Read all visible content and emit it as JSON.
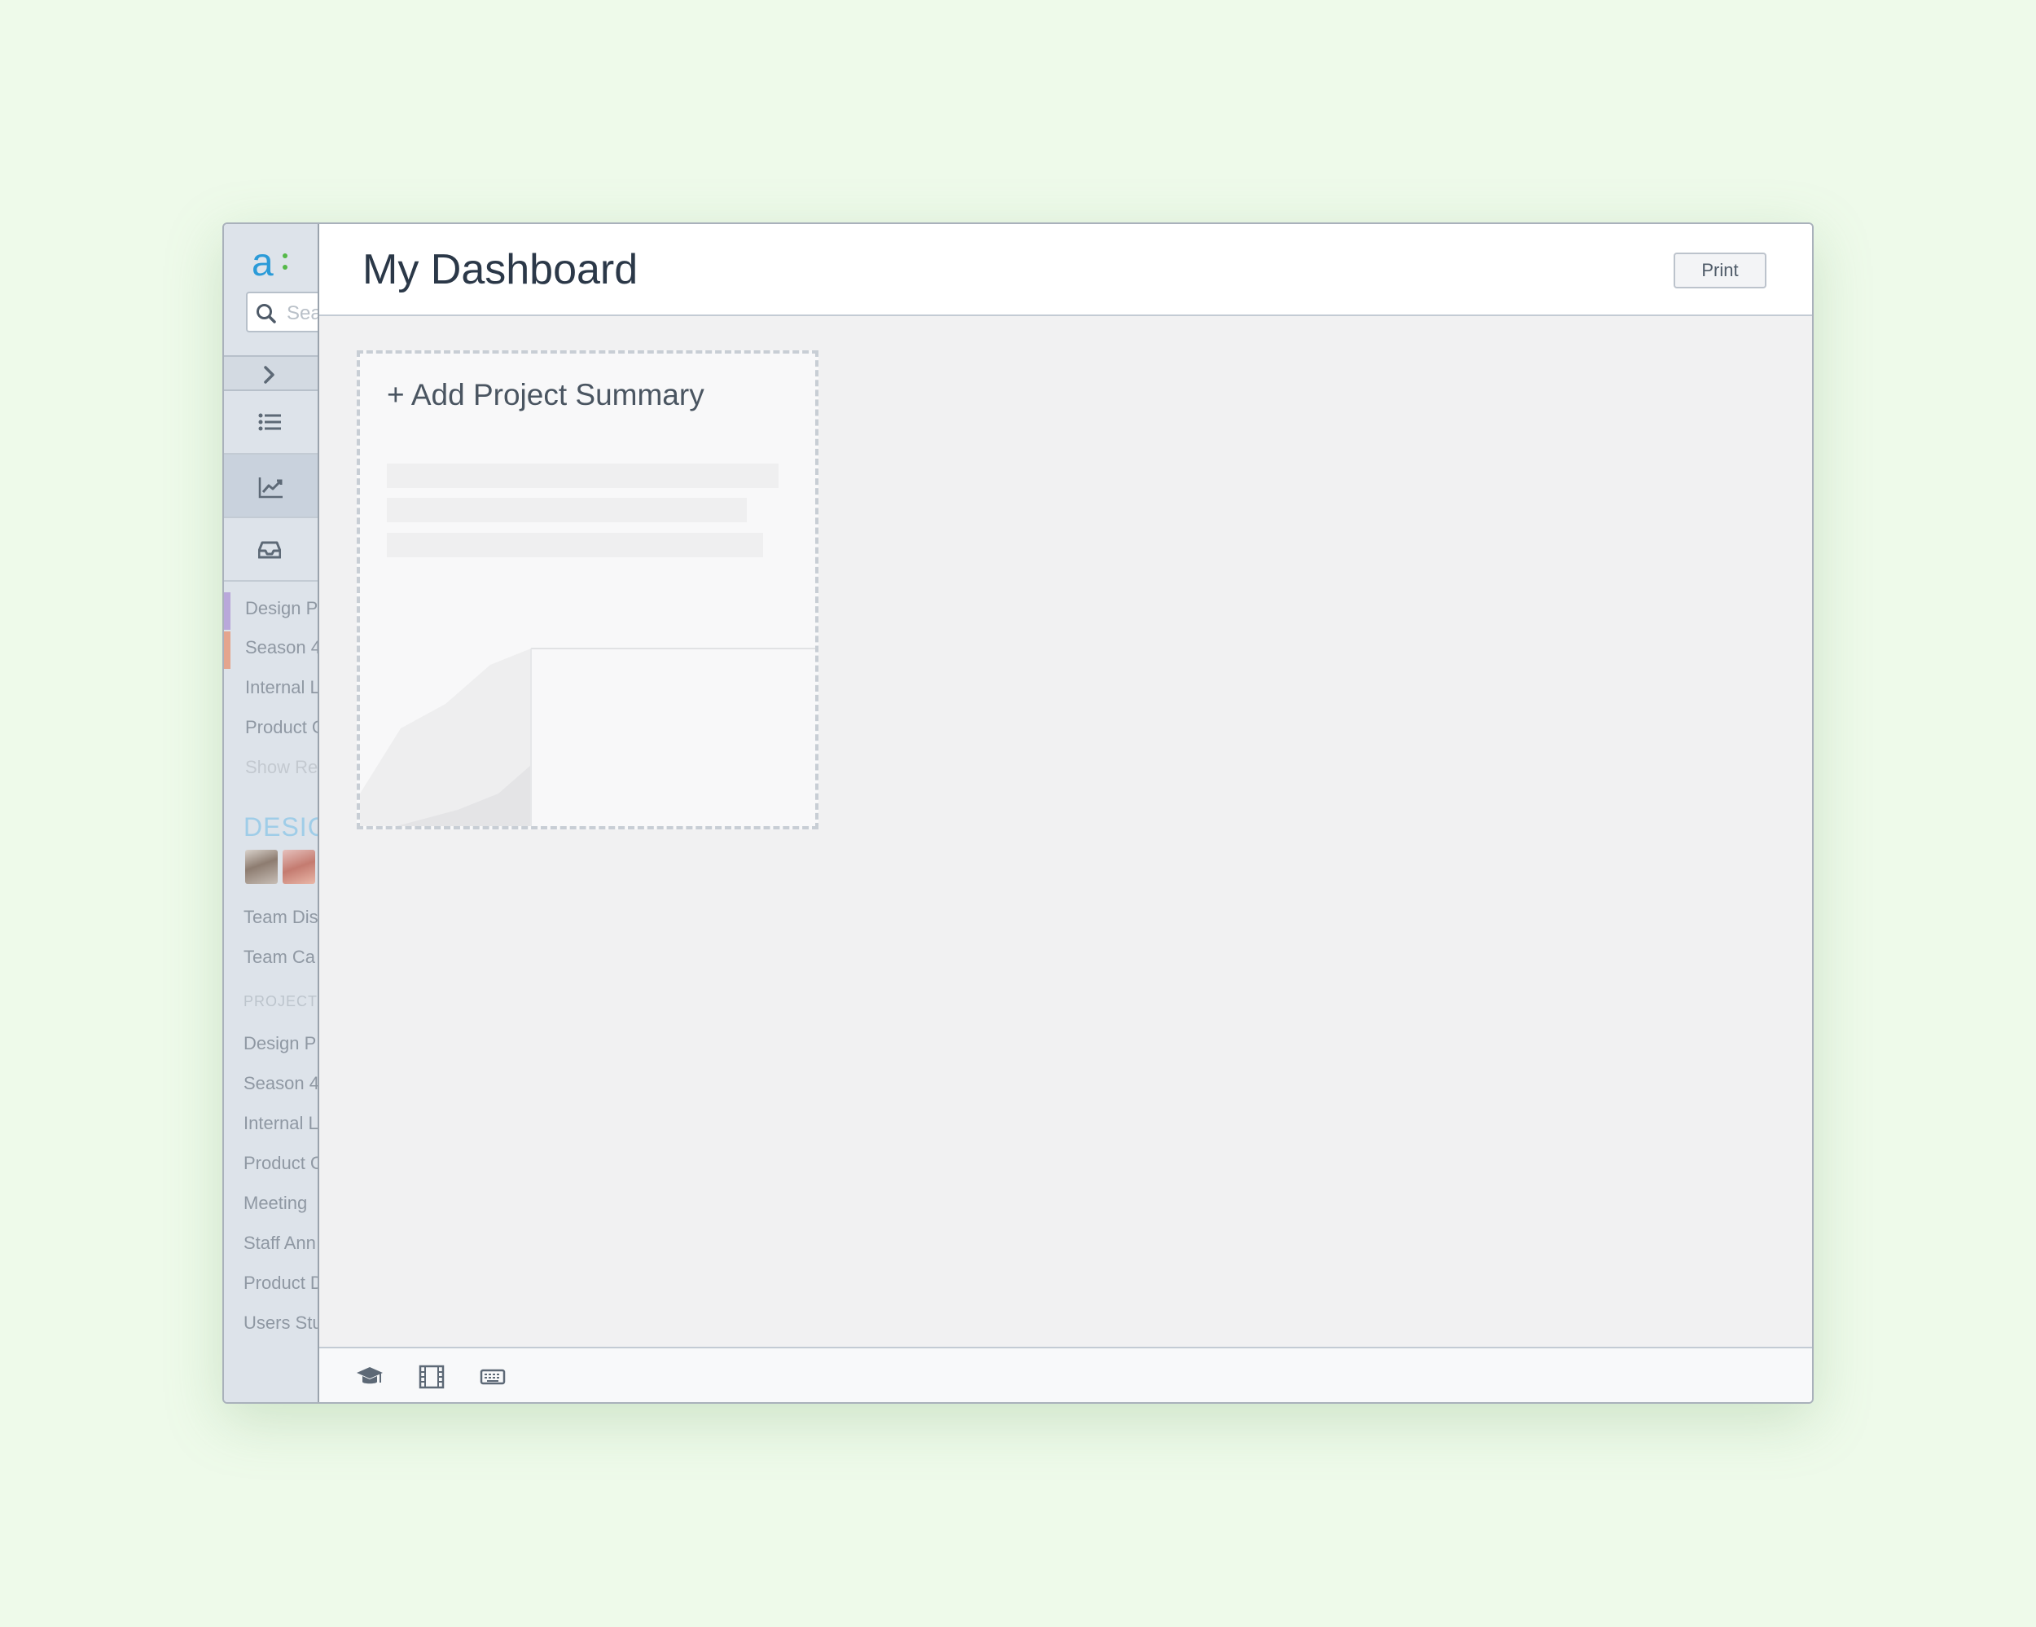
{
  "app": {
    "logo_text": "a"
  },
  "search": {
    "placeholder": "Search"
  },
  "sidebar": {
    "recent_projects": [
      "Design P",
      "Season 4",
      "Internal L",
      "Product C"
    ],
    "show_recent": "Show Re",
    "team_heading": "DESIGN",
    "team_links": [
      "Team Dis",
      "Team Ca"
    ],
    "projects_heading": "PROJECT",
    "projects": [
      "Design P",
      "Season 4",
      "Internal L",
      "Product C",
      "Meeting",
      "Staff Ann",
      "Product D",
      "Users Stu"
    ],
    "project_colors": [
      "#b9a8da",
      "#e4a58e"
    ]
  },
  "header": {
    "title": "My Dashboard",
    "print_label": "Print"
  },
  "card": {
    "title": "+ Add Project Summary"
  }
}
